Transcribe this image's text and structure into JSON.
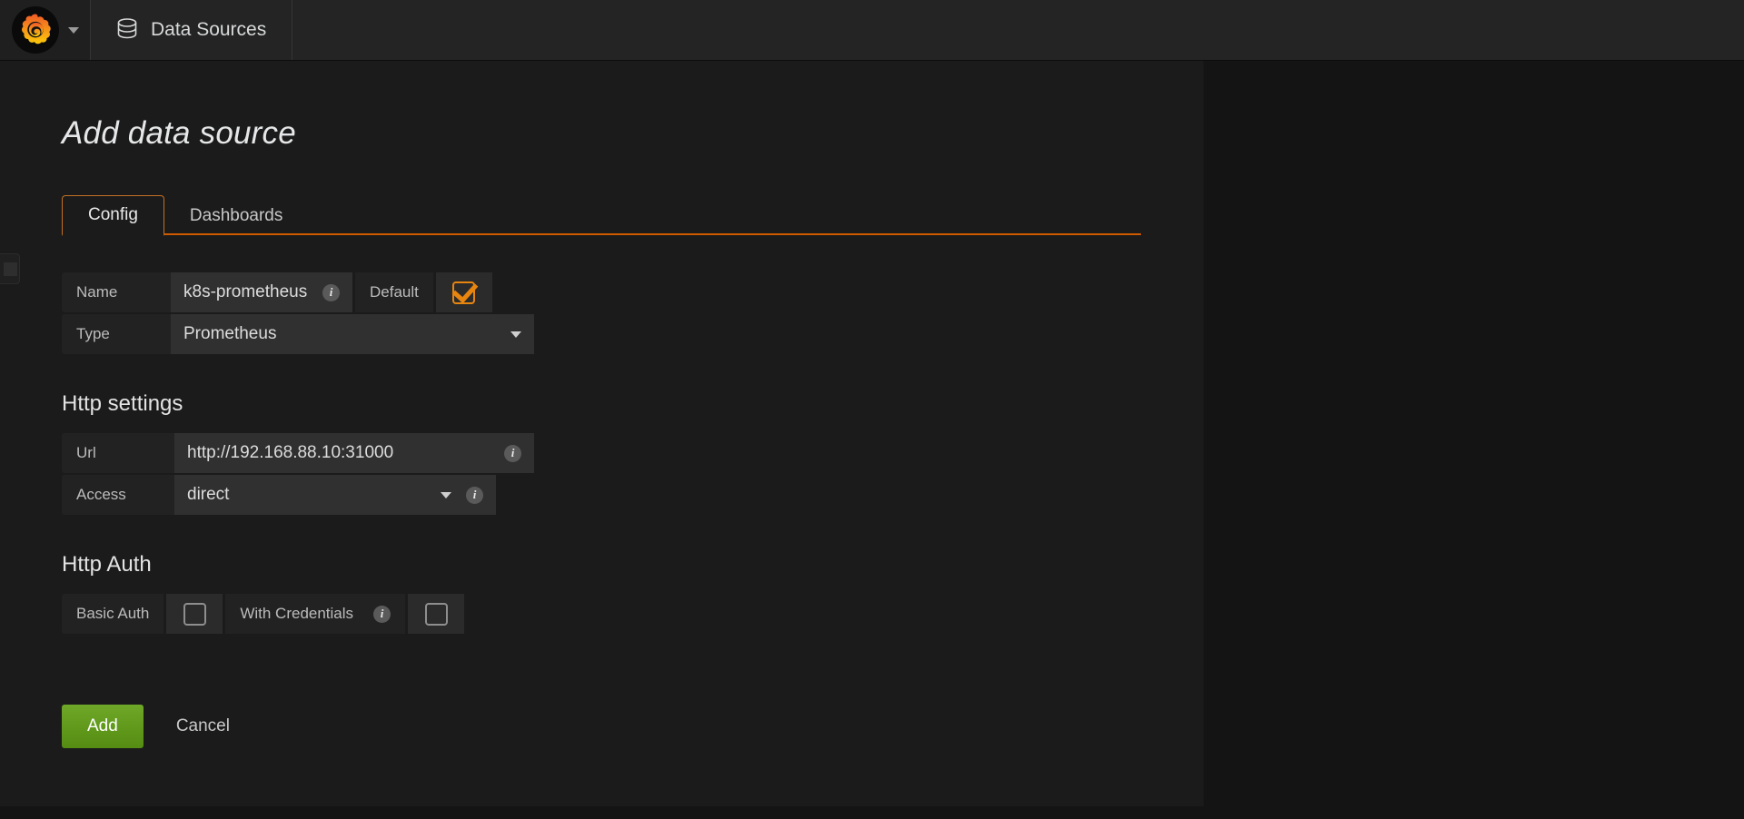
{
  "navbar": {
    "logo_icon": "grafana-logo-icon",
    "dropdown_icon": "chevron-down-icon",
    "item_icon": "database-icon",
    "item_label": "Data Sources"
  },
  "page": {
    "title": "Add data source"
  },
  "tabs": [
    {
      "label": "Config",
      "active": true
    },
    {
      "label": "Dashboards",
      "active": false
    }
  ],
  "form": {
    "name": {
      "label": "Name",
      "value": "k8s-prometheus",
      "info_icon": "info-icon"
    },
    "default": {
      "label": "Default",
      "checked": true
    },
    "type": {
      "label": "Type",
      "value": "Prometheus",
      "caret_icon": "chevron-down-icon"
    }
  },
  "http_settings": {
    "title": "Http settings",
    "url": {
      "label": "Url",
      "value": "http://192.168.88.10:31000",
      "info_icon": "info-icon"
    },
    "access": {
      "label": "Access",
      "value": "direct",
      "caret_icon": "chevron-down-icon",
      "info_icon": "info-icon"
    }
  },
  "http_auth": {
    "title": "Http Auth",
    "basic_auth": {
      "label": "Basic Auth",
      "checked": false
    },
    "with_credentials": {
      "label": "With Credentials",
      "checked": false,
      "info_icon": "info-icon"
    }
  },
  "actions": {
    "add_label": "Add",
    "cancel_label": "Cancel"
  },
  "colors": {
    "accent_orange": "#e8850f",
    "tab_border": "#c27024",
    "tab_underline": "#cf5a00",
    "add_button_green": "#629e21",
    "panel_bg": "#1b1b1b",
    "navbar_bg": "#242424",
    "input_bg": "#303030",
    "label_bg": "#222222"
  }
}
